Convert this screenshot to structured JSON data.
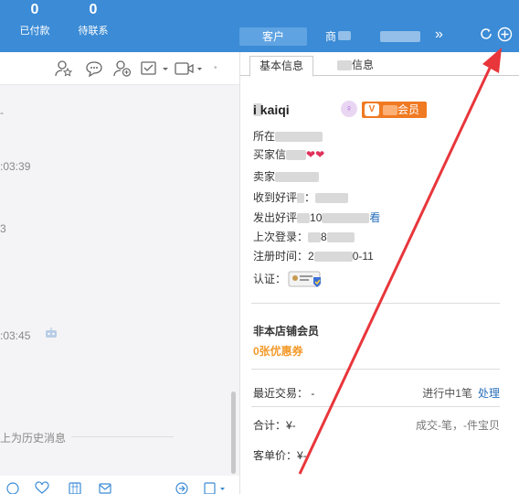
{
  "header": {
    "stats": [
      {
        "value": "0",
        "label": "已付款"
      },
      {
        "value": "0",
        "label": "待联系"
      }
    ],
    "tabs": [
      {
        "label": "客户",
        "active": true
      },
      {
        "label": "商",
        "active": false
      }
    ],
    "more_icon": "double-chevron-right-icon",
    "accent": "#3b8bd6"
  },
  "chat": {
    "fragments": [
      {
        "text": "-"
      },
      {
        "text": ":03:39"
      },
      {
        "text": "3"
      },
      {
        "text": ":03:45"
      }
    ],
    "history_label": "上为历史消息"
  },
  "panel": {
    "tabs": [
      {
        "label": "基本信息",
        "active": true
      },
      {
        "label": "信息",
        "active": false
      }
    ],
    "username": "i kaiqi",
    "vip_label": "会员",
    "fields": [
      {
        "label": "所在",
        "value": ""
      },
      {
        "label": "买家信",
        "value": "❤❤"
      },
      {
        "label": "卖家",
        "value": ""
      },
      {
        "label": "收到好评",
        "value": "："
      },
      {
        "label": "发出好评",
        "value": "10",
        "link": "看"
      },
      {
        "label": "上次登录：",
        "value": "8"
      },
      {
        "label": "注册时间：",
        "value": "2",
        "value_end": "0-11"
      },
      {
        "label": "认证：",
        "value": ""
      }
    ],
    "member_status": "非本店铺会员",
    "coupons": "0张优惠券",
    "recent_trade": {
      "label": "最近交易：",
      "value": "-",
      "status": "进行中1笔",
      "action": "处理"
    },
    "total": {
      "label": "合计：¥-",
      "summary": "成交-笔，-件宝贝"
    },
    "unit_price": {
      "label": "客单价：¥-"
    }
  },
  "colors": {
    "link": "#2a6fba",
    "vip": "#f07a22",
    "coupon": "#f39a2b",
    "annotation_arrow": "#e8363b"
  }
}
